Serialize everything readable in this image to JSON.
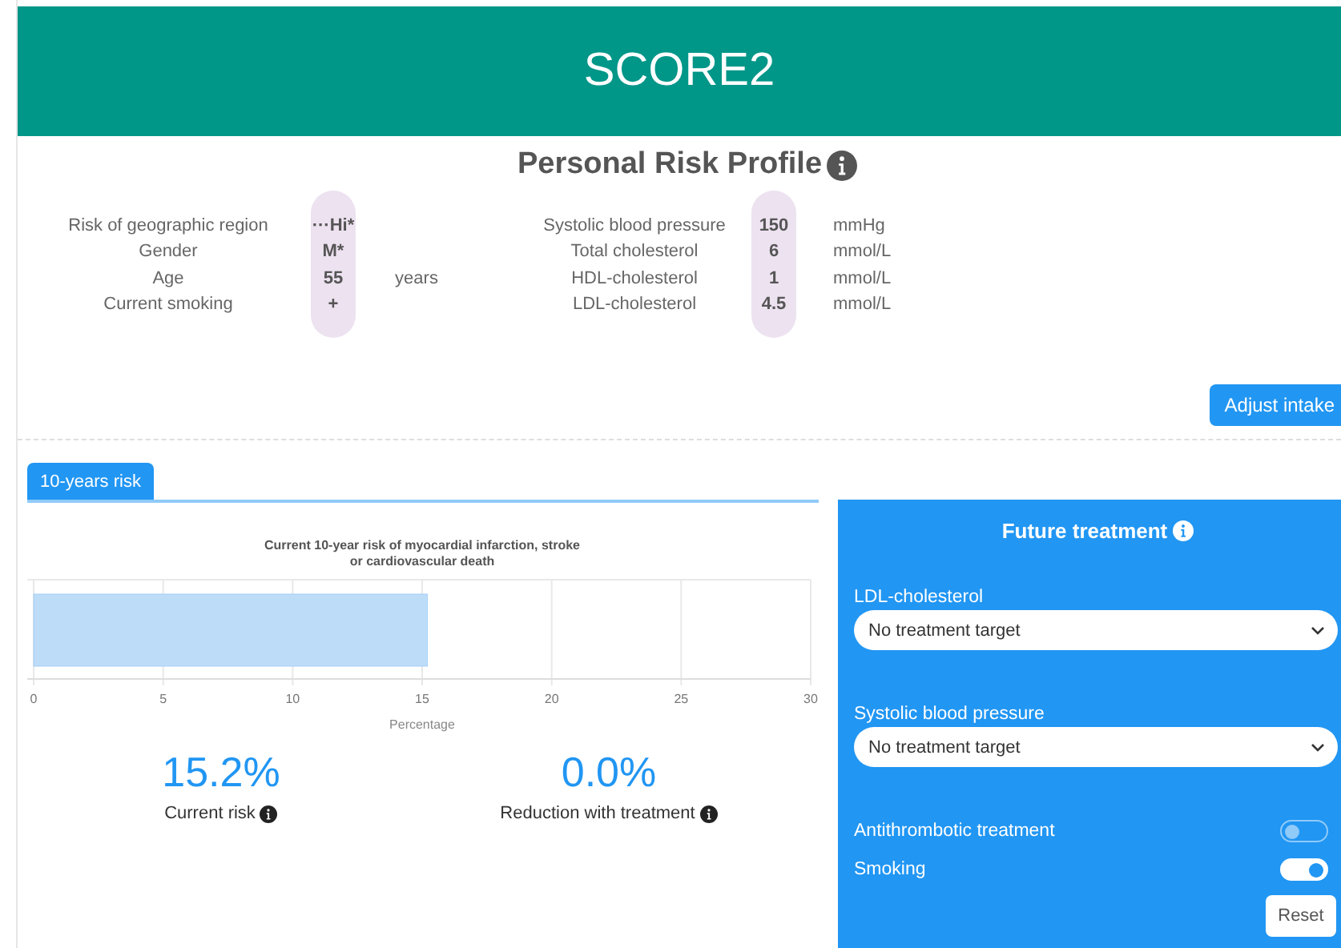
{
  "header": {
    "title": "SCORE2"
  },
  "profile": {
    "title": "Personal Risk Profile",
    "groups": [
      {
        "rows": [
          {
            "label": "Risk of geographic region",
            "value": "···Hi*",
            "unit": ""
          },
          {
            "label": "Gender",
            "value": "M*",
            "unit": ""
          },
          {
            "label": "Age",
            "value": "55",
            "unit": "years"
          },
          {
            "label": "Current smoking",
            "value": "+",
            "unit": ""
          }
        ]
      },
      {
        "rows": [
          {
            "label": "Systolic blood pressure",
            "value": "150",
            "unit": "mmHg"
          },
          {
            "label": "Total cholesterol",
            "value": "6",
            "unit": "mmol/L"
          },
          {
            "label": "HDL-cholesterol",
            "value": "1",
            "unit": "mmol/L"
          },
          {
            "label": "LDL-cholesterol",
            "value": "4.5",
            "unit": "mmol/L"
          }
        ]
      }
    ],
    "button": "Adjust intake"
  },
  "tabs": [
    {
      "label": "10-years risk",
      "selected": true
    }
  ],
  "chart_data": {
    "type": "bar",
    "orientation": "horizontal",
    "title": "Current 10-year risk of myocardial infarction, stroke or cardiovascular death",
    "xlabel": "Percentage",
    "values": [
      15.2
    ],
    "xlim": [
      0,
      30
    ],
    "xticks": [
      0,
      5,
      10,
      15,
      20,
      25,
      30
    ],
    "grid": true
  },
  "stats": [
    {
      "value": "15.2%",
      "label": "Current risk"
    },
    {
      "value": "0.0%",
      "label": "Reduction with treatment"
    }
  ],
  "treatment": {
    "title": "Future treatment",
    "selects": [
      {
        "label": "LDL-cholesterol",
        "value": "No treatment target"
      },
      {
        "label": "Systolic blood pressure",
        "value": "No treatment target"
      }
    ],
    "toggles": [
      {
        "label": "Antithrombotic treatment",
        "on": false
      },
      {
        "label": "Smoking",
        "on": true
      }
    ],
    "button": "Reset"
  }
}
